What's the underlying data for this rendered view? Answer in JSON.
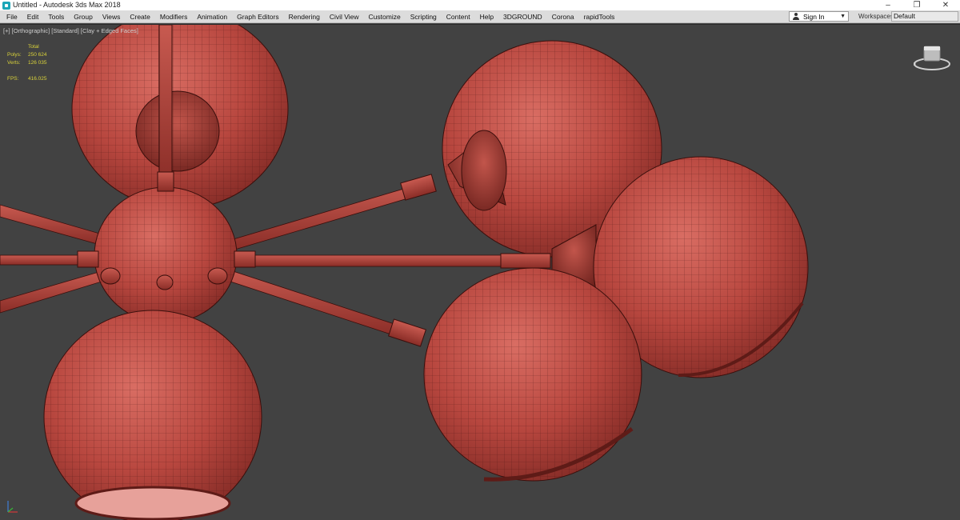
{
  "window": {
    "title": "Untitled - Autodesk 3ds Max 2018",
    "icon": "3ds-max-app-icon",
    "controls": {
      "minimize": "–",
      "restore": "❐",
      "close": "✕"
    }
  },
  "menu": {
    "items": [
      "File",
      "Edit",
      "Tools",
      "Group",
      "Views",
      "Create",
      "Modifiers",
      "Animation",
      "Graph Editors",
      "Rendering",
      "Civil View",
      "Customize",
      "Scripting",
      "Content",
      "Help",
      "3DGROUND",
      "Corona",
      "rapidTools"
    ],
    "signin_label": "Sign In",
    "workspaces_label": "Workspaces:",
    "workspace_value": "Default"
  },
  "viewport": {
    "label": "[+] [Orthographic] [Standard] [Clay + Edged Faces]",
    "stats": {
      "header": "Total",
      "polys_label": "Polys:",
      "polys_value": "250 624",
      "verts_label": "Verts:",
      "verts_value": "126 035",
      "fps_label": "FPS:",
      "fps_value": "416.025"
    },
    "colors": {
      "background": "#424242",
      "clay": "#b8473f",
      "stats": "#d9d23a"
    }
  }
}
